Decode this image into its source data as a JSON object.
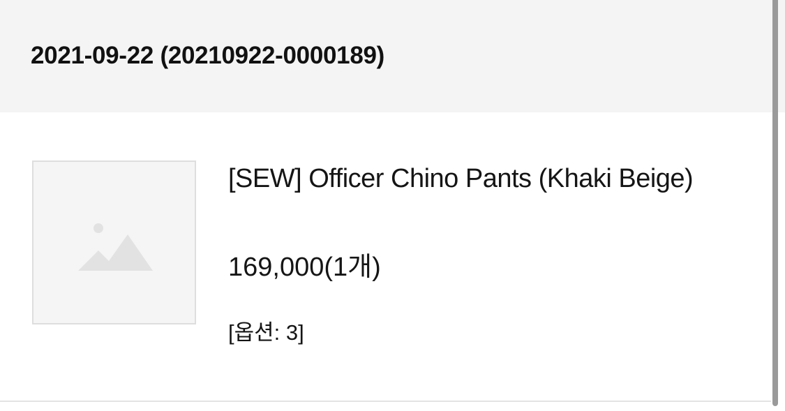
{
  "order": {
    "title": "2021-09-22 (20210922-0000189)"
  },
  "product": {
    "image_icon": "image-placeholder-icon",
    "name": "[SEW] Officer Chino Pants (Khaki Beige)",
    "price": "169,000(1개)",
    "option": "[옵션: 3]"
  },
  "colors": {
    "header_background": "#f4f4f4",
    "thumbnail_background": "#f5f5f5",
    "thumbnail_border": "#dedede",
    "placeholder_icon": "#e2e2e2",
    "text": "#151515",
    "scrollbar": "#9a9a9a"
  }
}
